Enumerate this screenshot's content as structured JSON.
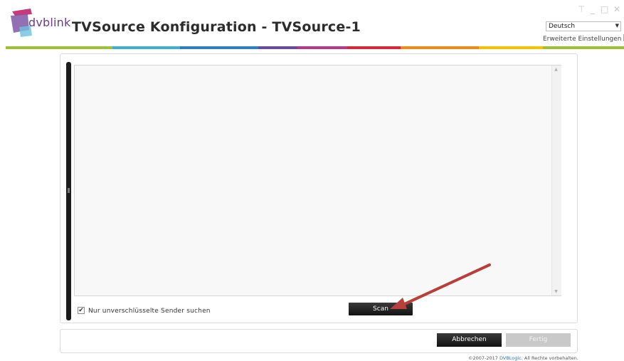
{
  "header": {
    "logo_text": "dvblink",
    "title": "TVSource Konfiguration - TVSource-1",
    "window_controls": [
      "pin-icon",
      "minimize-icon",
      "maximize-icon",
      "close-icon"
    ],
    "language": {
      "selected": "Deutsch"
    },
    "advanced_settings_label": "Erweiterte Einstellungen"
  },
  "brand_band_colors": [
    "#9dc03a",
    "#3fb0c8",
    "#2f7fc0",
    "#6a4a9c",
    "#b23a8c",
    "#d8263b",
    "#f28a1a",
    "#f3c200",
    "#9dc03a"
  ],
  "scan": {
    "checkbox_checked": true,
    "checkbox_label": "Nur unverschlüsselte Sender suchen",
    "scan_button": "Scan"
  },
  "footer": {
    "cancel_button": "Abbrechen",
    "finish_button": "Fertig",
    "copyright_prefix": "©2007-2017 ",
    "copyright_link": "DVBLogic",
    "copyright_suffix": ". All Rechte vorbehalten."
  },
  "colors": {
    "accent_dark": "#1c1c1c",
    "annotation_arrow": "#b5403c"
  }
}
